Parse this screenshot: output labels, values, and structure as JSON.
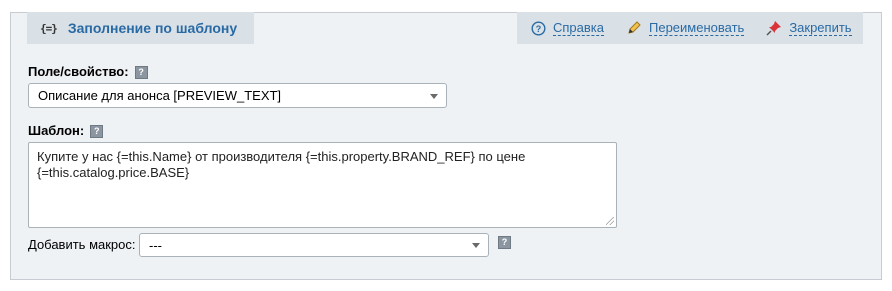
{
  "header": {
    "template_icon": "{=}",
    "title": "Заполнение по шаблону"
  },
  "actions": [
    {
      "icon": "help-circle-icon",
      "label": "Справка"
    },
    {
      "icon": "pencil-icon",
      "label": "Переименовать"
    },
    {
      "icon": "pin-icon",
      "label": "Закрепить"
    }
  ],
  "field": {
    "label": "Поле/свойство:",
    "selected": "Описание для анонса [PREVIEW_TEXT]"
  },
  "template": {
    "label": "Шаблон:",
    "line1": "Купите у нас {=this.Name} от производителя {=this.property.BRAND_REF} по цене",
    "line2": "{=this.catalog.price.BASE}"
  },
  "macro": {
    "label": "Добавить макрос:",
    "selected": "---"
  },
  "help_mark": "?",
  "colors": {
    "link": "#2a6aa4",
    "panel": "#eef2f5",
    "tab": "#d9e1e7"
  }
}
